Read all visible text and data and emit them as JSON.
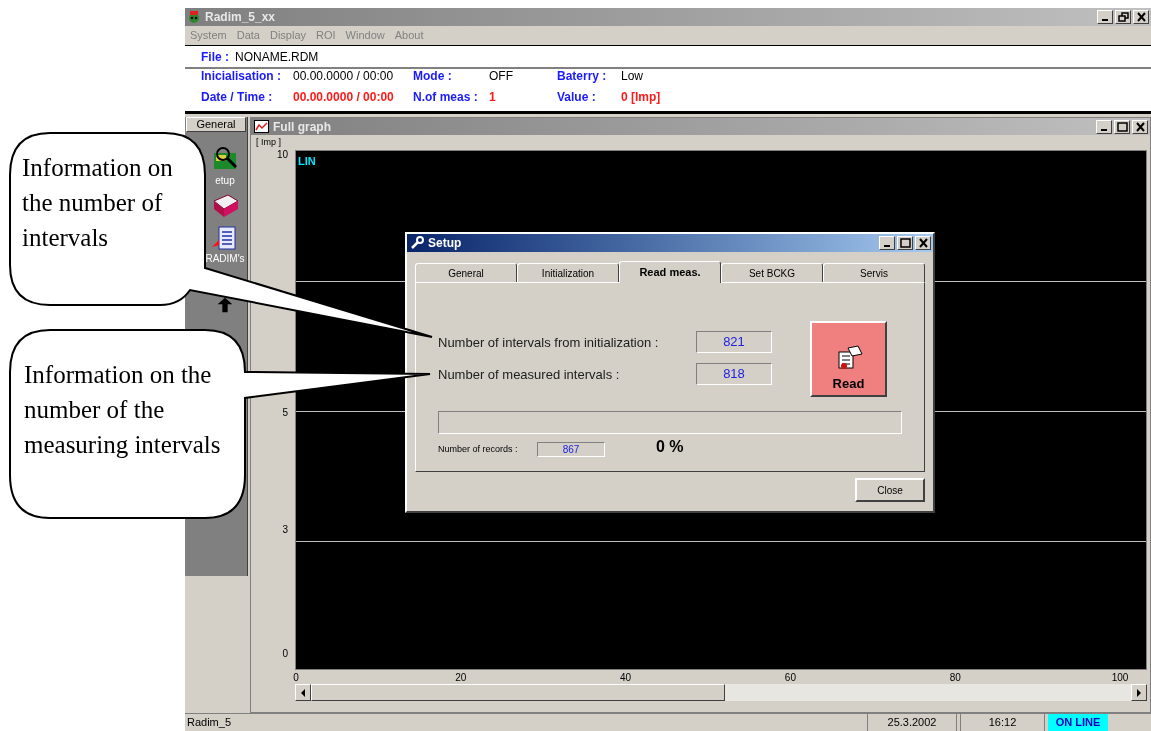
{
  "window": {
    "title": "Radim_5_xx"
  },
  "menu": [
    "System",
    "Data",
    "Display",
    "ROI",
    "Window",
    "About"
  ],
  "file": {
    "label": "File :",
    "value": "NONAME.RDM"
  },
  "info": [
    {
      "label": "Inicialisation :",
      "value": "00.00.0000 / 00:00",
      "alert": false
    },
    {
      "label": "Date / Time :",
      "value": "00.00.0000 / 00:00",
      "alert": true
    },
    {
      "label": "Mode :",
      "value": "OFF",
      "alert": false
    },
    {
      "label": "N.of meas :",
      "value": "1",
      "alert": true
    },
    {
      "label": "Baterry :",
      "value": "Low",
      "alert": false
    },
    {
      "label": "Value :",
      "value": "0 [Imp]",
      "alert": true
    }
  ],
  "sidebar": {
    "tab": "General",
    "items": [
      {
        "kind": "setup",
        "label": "etup"
      },
      {
        "kind": "book"
      },
      {
        "kind": "report",
        "label": "RADIM's"
      },
      {
        "kind": "arrow"
      }
    ]
  },
  "graph": {
    "title": "Full graph",
    "unit": "[ Imp ]",
    "mode": "LIN",
    "y_ticks": [
      "10",
      "5",
      "3",
      "0"
    ],
    "x_ticks": [
      "0",
      "20",
      "40",
      "60",
      "80",
      "100"
    ]
  },
  "dialog": {
    "title": "Setup",
    "tabs": [
      {
        "label": "General",
        "selected": false
      },
      {
        "label": "Initialization",
        "selected": false
      },
      {
        "label": "Read meas.",
        "selected": true
      },
      {
        "label": "Set BCKG",
        "selected": false
      },
      {
        "label": "Servis",
        "selected": false
      }
    ],
    "fields": [
      {
        "label": "Number of intervals from initialization :",
        "value": "821"
      },
      {
        "label": "Number of measured intervals :",
        "value": "818"
      }
    ],
    "read_button": "Read",
    "progress": {
      "level": 0,
      "reading": "0 %"
    },
    "records": {
      "label": "Number of records :",
      "value": "867"
    },
    "close_button": "Close"
  },
  "status_bar": {
    "name": "Radim_5",
    "date": "25.3.2002",
    "time": "16:12",
    "connection": "ON LINE",
    "online": true
  },
  "callouts": [
    "Information on the number of intervals",
    "Information on the number of the measuring intervals"
  ]
}
